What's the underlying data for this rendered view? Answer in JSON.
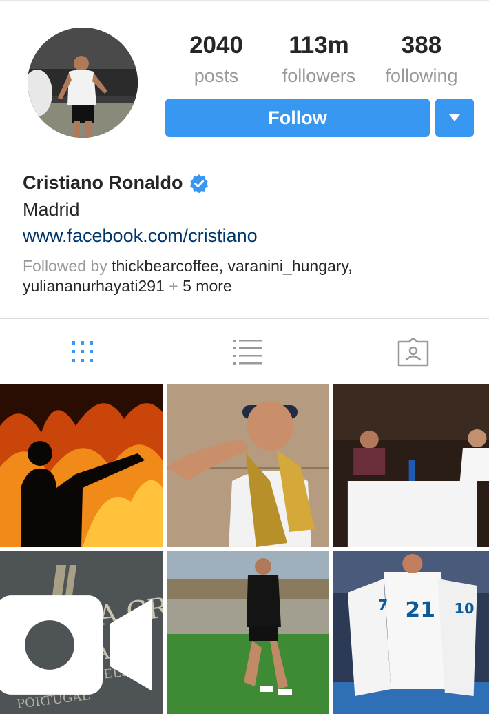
{
  "profile": {
    "name": "Cristiano Ronaldo",
    "location": "Madrid",
    "website": "www.facebook.com/cristiano",
    "followed_by_prefix": "Followed by",
    "followed_by_users": [
      "thickbearcoffee",
      "varanini_hungary",
      "yuliananurhayati291"
    ],
    "followed_by_more_prefix": "+",
    "followed_by_more": "5 more"
  },
  "stats": {
    "posts": {
      "value": "2040",
      "label": "posts"
    },
    "followers": {
      "value": "113m",
      "label": "followers"
    },
    "following": {
      "value": "388",
      "label": "following"
    }
  },
  "actions": {
    "follow_label": "Follow"
  },
  "tabs": {
    "grid": "grid-icon",
    "list": "list-icon",
    "tagged": "tagged-person-icon",
    "active": "grid"
  },
  "colors": {
    "accent": "#3897f0",
    "link": "#003569",
    "muted": "#999999",
    "verified": "#3897f0"
  },
  "photos": [
    {
      "subject": "silhouette pointing at fire"
    },
    {
      "subject": "man holding gold sneakers"
    },
    {
      "subject": "couple at restaurant table"
    },
    {
      "subject": "Pestana CR7 Lisboa sign",
      "badge": "video-icon"
    },
    {
      "subject": "player running on pitch"
    },
    {
      "subject": "team celebrating in white kits"
    }
  ]
}
